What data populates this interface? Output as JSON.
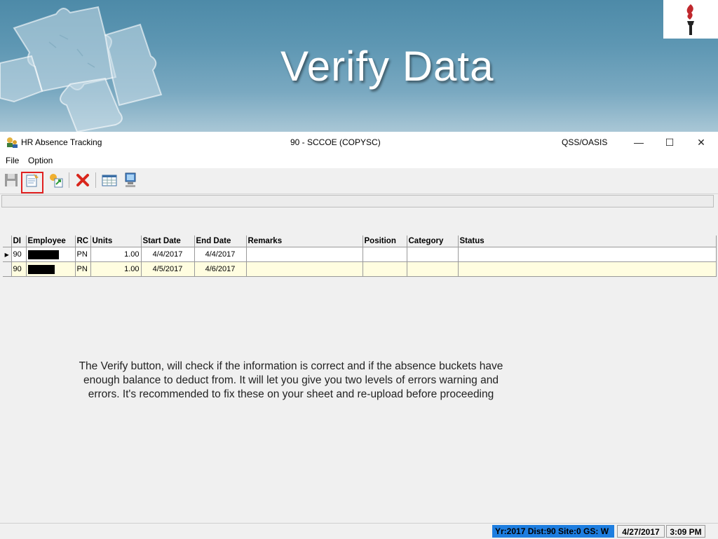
{
  "slide": {
    "title": "Verify Data"
  },
  "window": {
    "title": "HR Absence Tracking",
    "center_title": "90 - SCCOE (COPYSC)",
    "right_title": "QSS/OASIS",
    "minimize": "—",
    "maximize": "☐",
    "close": "✕"
  },
  "menu": {
    "file": "File",
    "option": "Option"
  },
  "grid": {
    "headers": [
      "DI",
      "Employee",
      "RC",
      "Units",
      "Start Date",
      "End Date",
      "Remarks",
      "Position",
      "Category",
      "Status"
    ],
    "rows": [
      {
        "di": "90",
        "employee": "",
        "rc": "PN",
        "units": "1.00",
        "start": "4/4/2017",
        "end": "4/4/2017",
        "remarks": "",
        "position": "",
        "category": "",
        "status": ""
      },
      {
        "di": "90",
        "employee": "",
        "rc": "PN",
        "units": "1.00",
        "start": "4/5/2017",
        "end": "4/6/2017",
        "remarks": "",
        "position": "",
        "category": "",
        "status": ""
      }
    ],
    "current_row_marker": "▶"
  },
  "note": {
    "line1": "The Verify button, will check if the information is correct and if the absence buckets have",
    "line2": "enough balance to deduct from.   It will let you give you two levels of errors warning and",
    "line3": "errors.   It's recommended to fix these on your sheet and re-upload before proceeding"
  },
  "status": {
    "info": "Yr:2017  Dist:90  Site:0 GS: W",
    "date": "4/27/2017",
    "time": "3:09 PM"
  },
  "colors": {
    "banner": "#5e97b3",
    "status_blue": "#1e7ee0",
    "row_alt": "#fffde0",
    "highlight": "#e02020"
  },
  "icons": [
    "save-icon",
    "verify-icon",
    "upload-icon",
    "delete-icon",
    "calendar-grid-icon",
    "computer-icon"
  ]
}
